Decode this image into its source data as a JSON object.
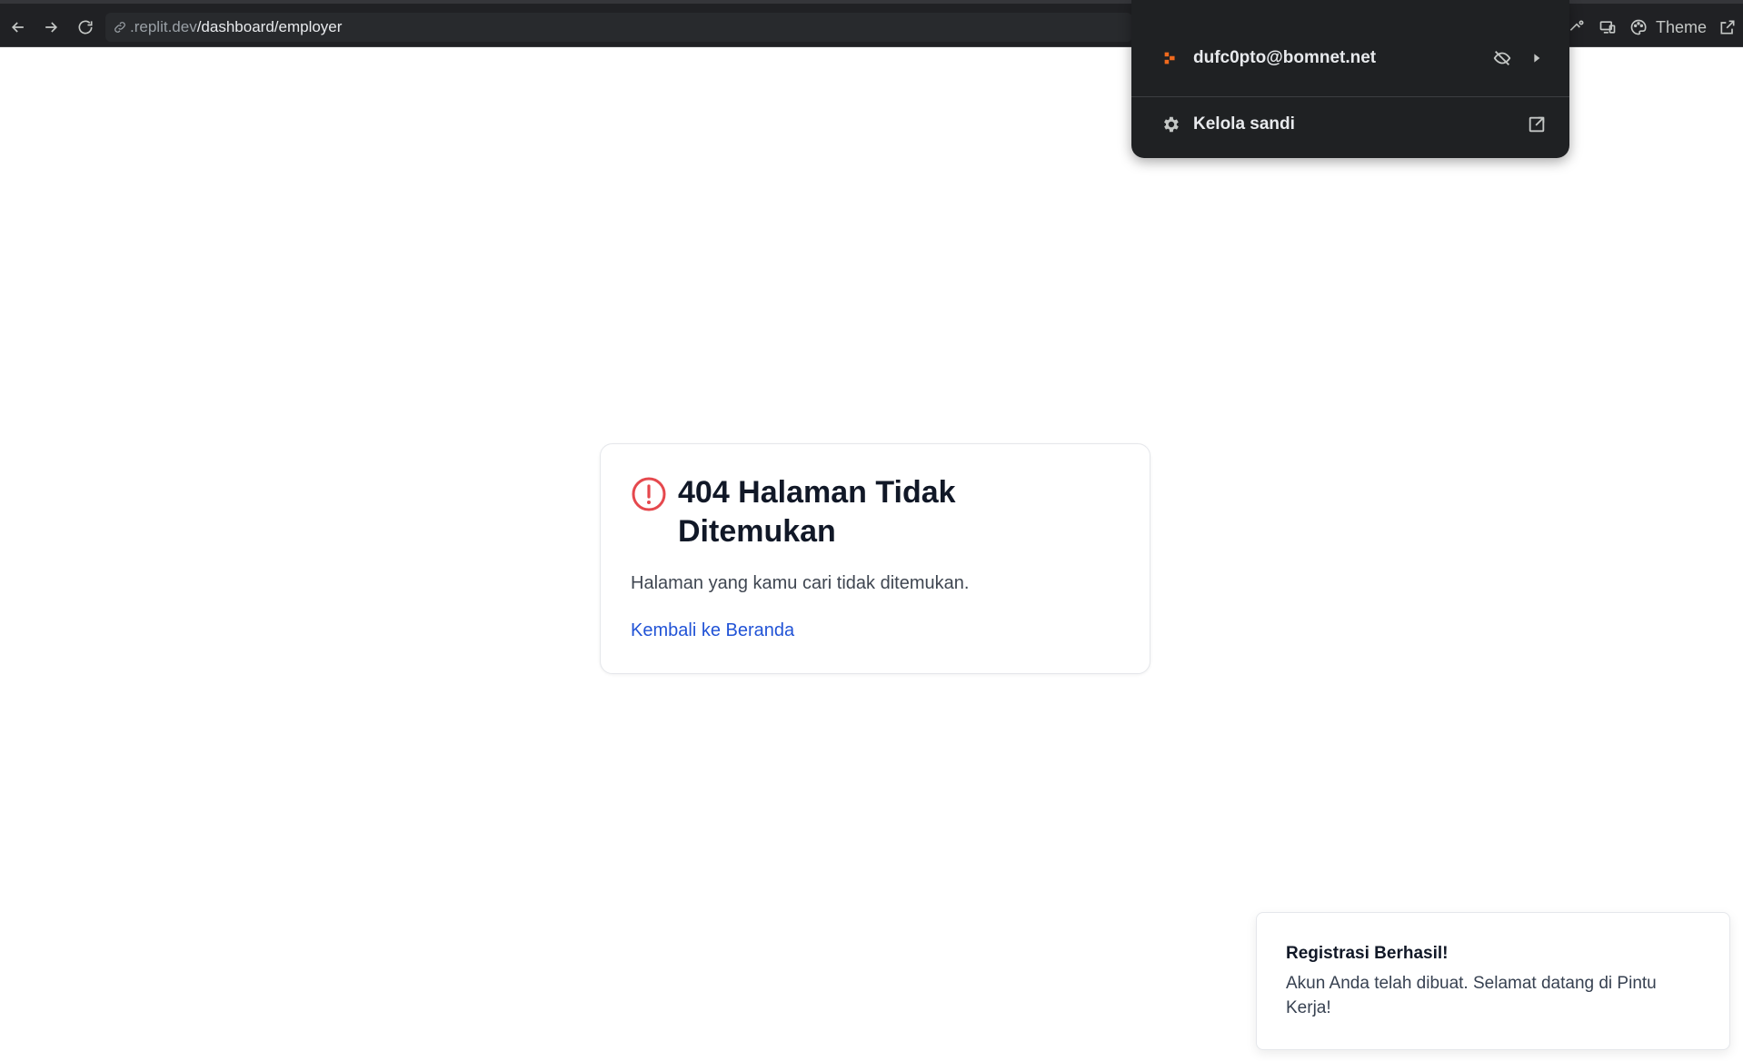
{
  "browser": {
    "url_host": ".replit.dev",
    "url_path": "/dashboard/employer",
    "theme_label": "Theme"
  },
  "password_popup": {
    "account_email": "dufc0pto@bomnet.net",
    "manage_label": "Kelola sandi"
  },
  "not_found": {
    "title": "404 Halaman Tidak Ditemukan",
    "message": "Halaman yang kamu cari tidak ditemukan.",
    "home_link": "Kembali ke Beranda"
  },
  "toast": {
    "title": "Registrasi Berhasil!",
    "body": "Akun Anda telah dibuat. Selamat datang di Pintu Kerja!"
  },
  "colors": {
    "error_icon": "#e5484d",
    "link": "#2153d6",
    "popup_bg": "#1f2123",
    "brand_icon": "#f06a1d"
  }
}
